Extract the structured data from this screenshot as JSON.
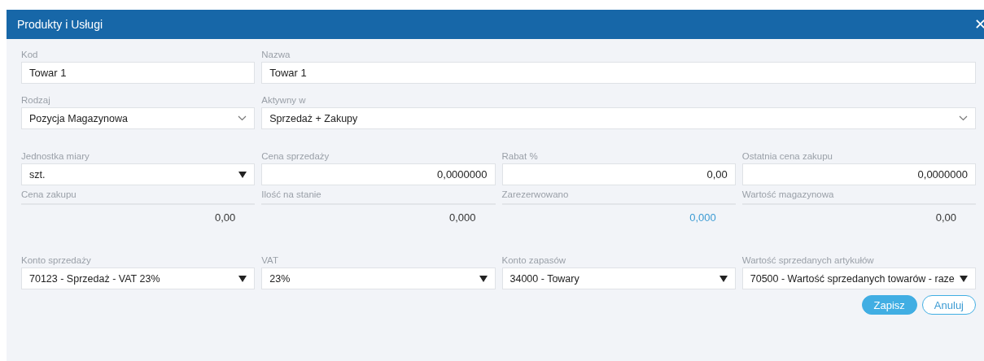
{
  "window": {
    "title": "Produkty i Usługi",
    "close": "✕"
  },
  "rows": [
    {
      "fields": [
        {
          "label": "Kod",
          "value": "Towar 1",
          "kind": "input"
        },
        {
          "label": "Nazwa",
          "value": "Towar 1",
          "kind": "input"
        }
      ]
    },
    {
      "fields": [
        {
          "label": "Rodzaj",
          "value": "Pozycja Magazynowa",
          "kind": "chevron"
        },
        {
          "label": "Aktywny w",
          "value": "Sprzedaż + Zakupy",
          "kind": "chevron"
        }
      ]
    },
    {
      "fields": [
        {
          "label": "Jednostka miary",
          "value": "szt.",
          "kind": "dropdown"
        },
        {
          "label": "Cena sprzedaży",
          "value": "0,0000000",
          "kind": "number"
        },
        {
          "label": "Rabat %",
          "value": "0,00",
          "kind": "number"
        },
        {
          "label": "Ostatnia cena zakupu",
          "value": "0,0000000",
          "kind": "number"
        }
      ]
    },
    {
      "fields": [
        {
          "label": "Cena zakupu",
          "value": "0,00",
          "kind": "readonly"
        },
        {
          "label": "Ilość na stanie",
          "value": "0,000",
          "kind": "readonly"
        },
        {
          "label": "Zarezerwowano",
          "value": "0,000",
          "kind": "link"
        },
        {
          "label": "Wartość magazynowa",
          "value": "0,00",
          "kind": "readonly"
        }
      ]
    },
    {
      "fields": [
        {
          "label": "Konto sprzedaży",
          "value": "70123 - Sprzedaż - VAT 23%",
          "kind": "dropdown"
        },
        {
          "label": "VAT",
          "value": "23%",
          "kind": "dropdown"
        },
        {
          "label": "Konto zapasów",
          "value": "34000 - Towary",
          "kind": "dropdown"
        },
        {
          "label": "Wartość sprzedanych artykułów",
          "value": "70500 - Wartość sprzedanych towarów - raze",
          "kind": "dropdown"
        }
      ]
    }
  ],
  "buttons": [
    {
      "label": "Zapisz",
      "kind": "primary"
    },
    {
      "label": "Anuluj",
      "kind": "secondary"
    }
  ]
}
